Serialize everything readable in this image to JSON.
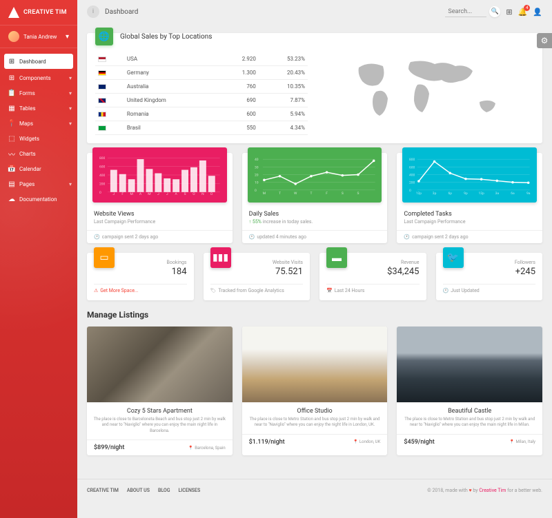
{
  "brand": "CREATIVE TIM",
  "user": "Tania Andrew",
  "nav": [
    {
      "icon": "⊞",
      "label": "Dashboard"
    },
    {
      "icon": "⊞",
      "label": "Components"
    },
    {
      "icon": "📋",
      "label": "Forms"
    },
    {
      "icon": "▦",
      "label": "Tables"
    },
    {
      "icon": "📍",
      "label": "Maps"
    },
    {
      "icon": "⬚",
      "label": "Widgets"
    },
    {
      "icon": "〰",
      "label": "Charts"
    },
    {
      "icon": "📅",
      "label": "Calendar"
    },
    {
      "icon": "▤",
      "label": "Pages"
    },
    {
      "icon": "☁",
      "label": "Documentation"
    }
  ],
  "topbar": {
    "title": "Dashboard",
    "search_placeholder": "Search...",
    "notif_count": "4"
  },
  "global_sales": {
    "title": "Global Sales by Top Locations",
    "rows": [
      {
        "country": "USA",
        "value": "2.920",
        "pct": "53.23%"
      },
      {
        "country": "Germany",
        "value": "1.300",
        "pct": "20.43%"
      },
      {
        "country": "Australia",
        "value": "760",
        "pct": "10.35%"
      },
      {
        "country": "United Kingdom",
        "value": "690",
        "pct": "7.87%"
      },
      {
        "country": "Romania",
        "value": "600",
        "pct": "5.94%"
      },
      {
        "country": "Brasil",
        "value": "550",
        "pct": "4.34%"
      }
    ]
  },
  "charts": [
    {
      "title": "Website Views",
      "sub": "Last Campaign Performance",
      "footer": "campaign sent 2 days ago"
    },
    {
      "title": "Daily Sales",
      "sub_prefix": "↑ 55%",
      "sub": " increase in today sales.",
      "footer": "updated 4 minutes ago"
    },
    {
      "title": "Completed Tasks",
      "sub": "Last Campaign Performance",
      "footer": "campaign sent 2 days ago"
    }
  ],
  "chart_data": [
    {
      "type": "bar",
      "categories": [
        "J",
        "F",
        "M",
        "A",
        "M",
        "J",
        "J",
        "A",
        "S",
        "O",
        "N",
        "D"
      ],
      "values": [
        520,
        420,
        300,
        770,
        540,
        440,
        320,
        300,
        520,
        580,
        740,
        380
      ],
      "ylim": [
        0,
        800
      ],
      "yticks": [
        0,
        200,
        400,
        600,
        800
      ]
    },
    {
      "type": "line",
      "x": [
        "M",
        "T",
        "W",
        "T",
        "F",
        "S",
        "S"
      ],
      "values": [
        13,
        18,
        8,
        18,
        23,
        19,
        20,
        38
      ],
      "ylim": [
        0,
        40
      ],
      "yticks": [
        0,
        10,
        20,
        30,
        40
      ]
    },
    {
      "type": "line",
      "x": [
        "12p",
        "3p",
        "6p",
        "9p",
        "12p",
        "3a",
        "6a",
        "9a"
      ],
      "values": [
        230,
        740,
        440,
        290,
        280,
        240,
        200,
        190
      ],
      "ylim": [
        0,
        800
      ],
      "yticks": [
        0,
        200,
        400,
        600,
        800
      ]
    }
  ],
  "stats": [
    {
      "label": "Bookings",
      "value": "184",
      "footer": "Get More Space...",
      "footer_icon": "⚠"
    },
    {
      "label": "Website Visits",
      "value": "75.521",
      "footer": "Tracked from Google Analytics",
      "footer_icon": "🏷"
    },
    {
      "label": "Revenue",
      "value": "$34,245",
      "footer": "Last 24 Hours",
      "footer_icon": "📅"
    },
    {
      "label": "Followers",
      "value": "+245",
      "footer": "Just Updated",
      "footer_icon": "🕐"
    }
  ],
  "listings_title": "Manage Listings",
  "listings": [
    {
      "title": "Cozy 5 Stars Apartment",
      "desc": "The place is close to Barceloneta Beach and bus stop just 2 min by walk and near to \"Naviglio\" where you can enjoy the main night life in Barcelona.",
      "price": "$899/night",
      "loc": "Barcelona, Spain"
    },
    {
      "title": "Office Studio",
      "desc": "The place is close to Metro Station and bus stop just 2 min by walk and near to \"Naviglio\" where you can enjoy the night life in London, UK.",
      "price": "$1.119/night",
      "loc": "London, UK"
    },
    {
      "title": "Beautiful Castle",
      "desc": "The place is close to Metro Station and bus stop just 2 min by walk and near to \"Naviglio\" where you can enjoy the main night life in Milan.",
      "price": "$459/night",
      "loc": "Milan, Italy"
    }
  ],
  "footer": {
    "links": [
      "CREATIVE TIM",
      "ABOUT US",
      "BLOG",
      "LICENSES"
    ],
    "copy_prefix": "© 2018, made with ",
    "copy_suffix": " by ",
    "copy_link": "Creative Tim",
    "copy_end": " for a better web."
  }
}
